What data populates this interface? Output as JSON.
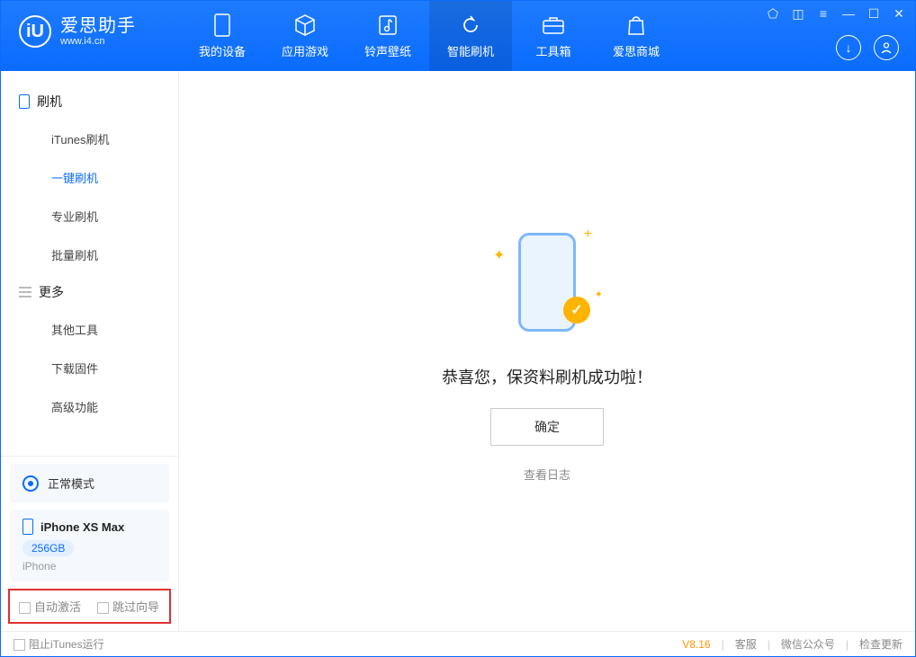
{
  "app": {
    "name": "爱思助手",
    "url": "www.i4.cn"
  },
  "nav": {
    "items": [
      {
        "label": "我的设备"
      },
      {
        "label": "应用游戏"
      },
      {
        "label": "铃声壁纸"
      },
      {
        "label": "智能刷机"
      },
      {
        "label": "工具箱"
      },
      {
        "label": "爱思商城"
      }
    ],
    "active_index": 3
  },
  "sidebar": {
    "group1": {
      "title": "刷机",
      "items": [
        {
          "label": "iTunes刷机"
        },
        {
          "label": "一键刷机"
        },
        {
          "label": "专业刷机"
        },
        {
          "label": "批量刷机"
        }
      ],
      "active_index": 1
    },
    "group2": {
      "title": "更多",
      "items": [
        {
          "label": "其他工具"
        },
        {
          "label": "下载固件"
        },
        {
          "label": "高级功能"
        }
      ]
    },
    "mode": {
      "label": "正常模式"
    },
    "device": {
      "name": "iPhone XS Max",
      "capacity": "256GB",
      "type": "iPhone"
    },
    "options": {
      "auto_activate": "自动激活",
      "skip_guide": "跳过向导"
    }
  },
  "main": {
    "success_text": "恭喜您，保资料刷机成功啦！",
    "ok_button": "确定",
    "view_log": "查看日志"
  },
  "status": {
    "block_itunes": "阻止iTunes运行",
    "version": "V8.16",
    "links": {
      "cs": "客服",
      "wechat": "微信公众号",
      "update": "检查更新"
    }
  }
}
